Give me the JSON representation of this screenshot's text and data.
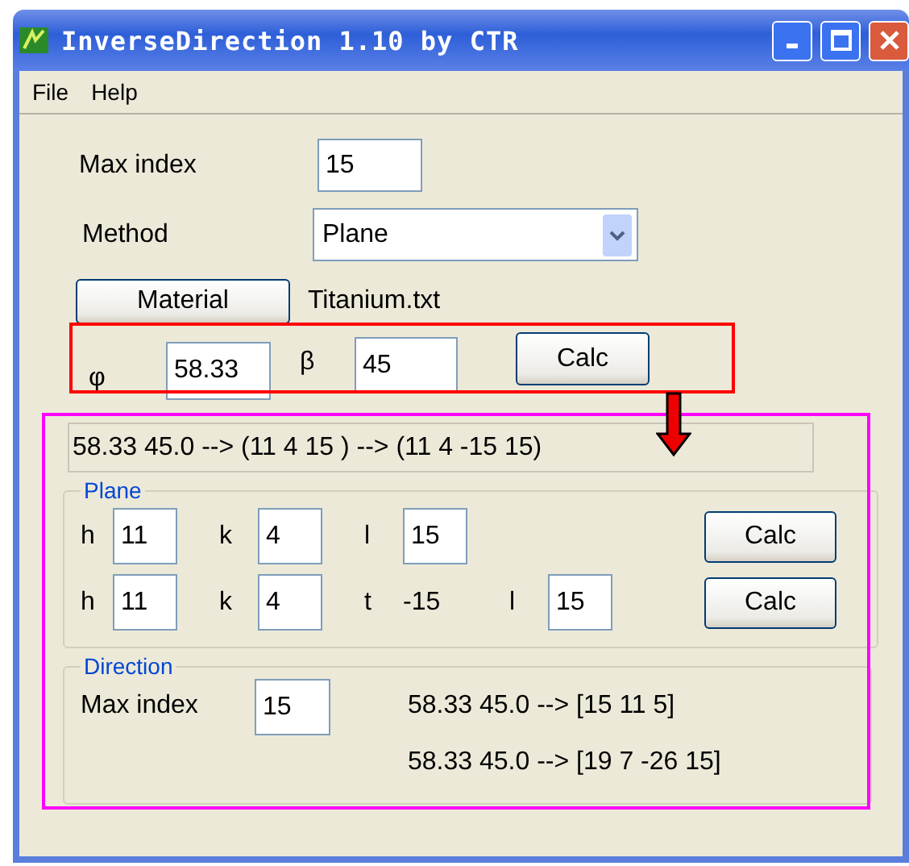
{
  "window": {
    "title": "InverseDirection 1.10 by CTR"
  },
  "menu": [
    "File",
    "Help"
  ],
  "max_index": {
    "label": "Max index",
    "value": "15"
  },
  "method": {
    "label": "Method",
    "value": "Plane"
  },
  "material": {
    "button": "Material",
    "file": "Titanium.txt"
  },
  "angles": {
    "phi_label": "φ",
    "phi": "58.33",
    "beta_label": "β",
    "beta": "45",
    "button": "Calc"
  },
  "result": "58.33 45.0 --> (11 4 15 ) --> (11 4 -15 15)",
  "plane": {
    "title": "Plane",
    "rows": [
      {
        "items": [
          {
            "kind": "input",
            "label": "h",
            "value": "11"
          },
          {
            "kind": "input",
            "label": "k",
            "value": "4"
          },
          {
            "kind": "input",
            "label": "l",
            "value": "15"
          }
        ],
        "button": "Calc"
      },
      {
        "items": [
          {
            "kind": "input",
            "label": "h",
            "value": "11"
          },
          {
            "kind": "input",
            "label": "k",
            "value": "4"
          },
          {
            "kind": "text",
            "label": "t",
            "value": "-15"
          },
          {
            "kind": "input",
            "label": "l",
            "value": "15"
          }
        ],
        "button": "Calc"
      }
    ]
  },
  "direction": {
    "title": "Direction",
    "label": "Max index",
    "value": "15",
    "results": [
      "58.33 45.0 --> [15 11 5]",
      "58.33 45.0 --> [19 7 -26 15]"
    ]
  }
}
